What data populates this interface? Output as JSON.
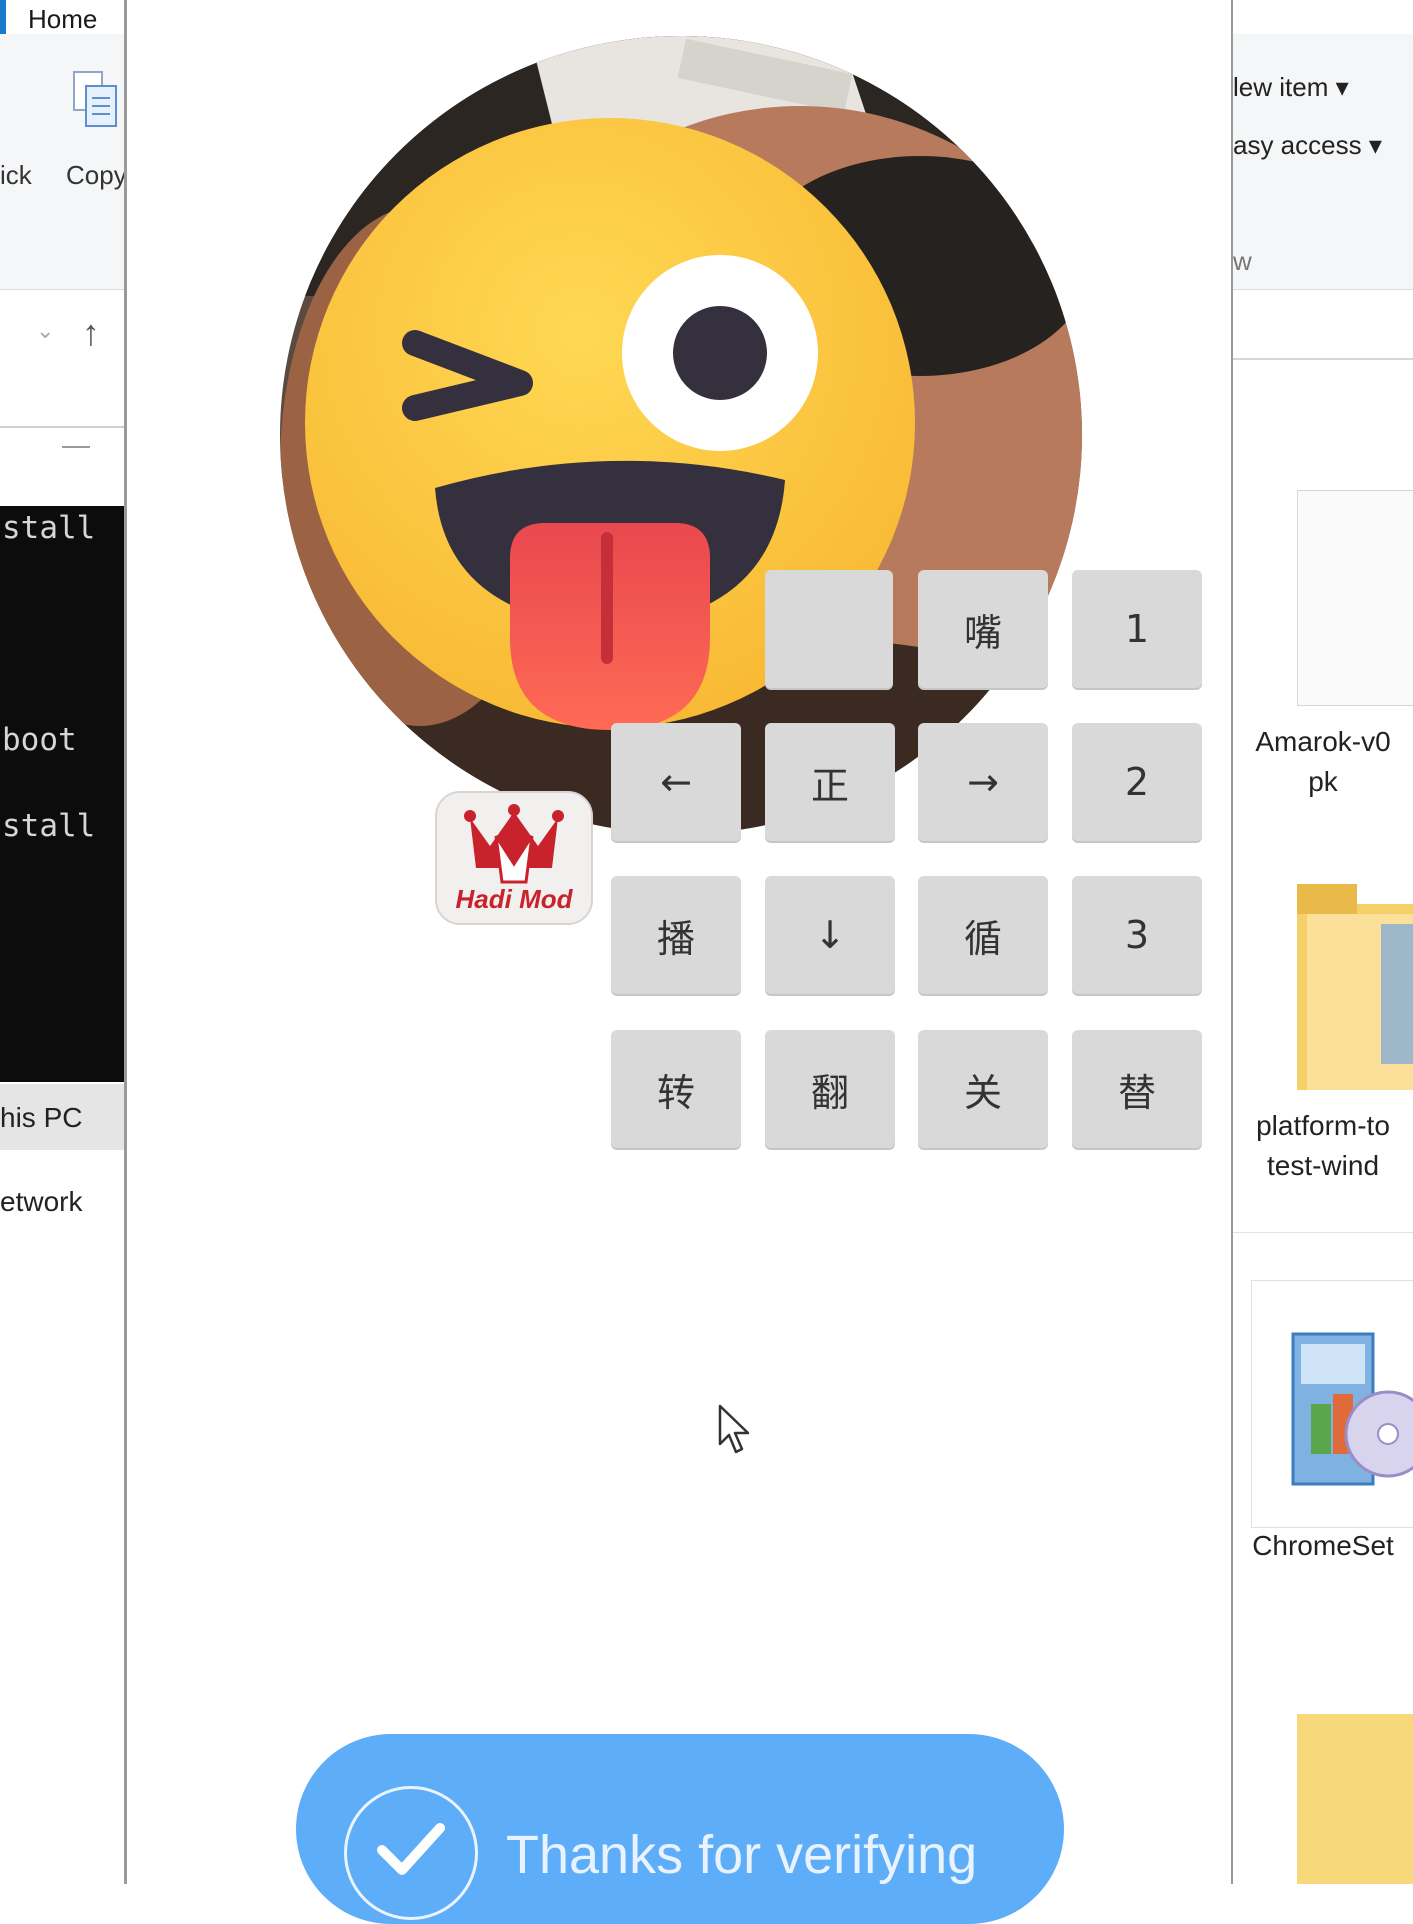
{
  "left_window": {
    "tab_home": "Home",
    "ribbon_labels": [
      "ick",
      "Copy"
    ],
    "console_lines": [
      "stall",
      "boot",
      "stall"
    ],
    "nav_items": [
      "his PC",
      "etwork"
    ]
  },
  "right_window": {
    "ribbon_items": [
      "lew item ▾",
      "asy access ▾",
      "w"
    ],
    "files": [
      {
        "label_lines": [
          "Amarok-v0",
          "pk"
        ]
      },
      {
        "label_lines": [
          "platform-to",
          "test-wind"
        ]
      },
      {
        "label_lines": [
          "ChromeSet"
        ]
      }
    ]
  },
  "center": {
    "logo_text": "Hadi Mod",
    "keypad": [
      [
        "",
        "嘴",
        "1"
      ],
      [
        "←",
        "正",
        "→",
        "2"
      ],
      [
        "播",
        "↓",
        "循",
        "3"
      ],
      [
        "转",
        "翻",
        "关",
        "替"
      ]
    ],
    "verify_text": "Thanks for verifying"
  },
  "colors": {
    "verify_bar": "#5eadf9",
    "key_bg": "#d9d9d9",
    "emoji_yellow": "#fdc83b",
    "tongue": "#f0555a"
  }
}
